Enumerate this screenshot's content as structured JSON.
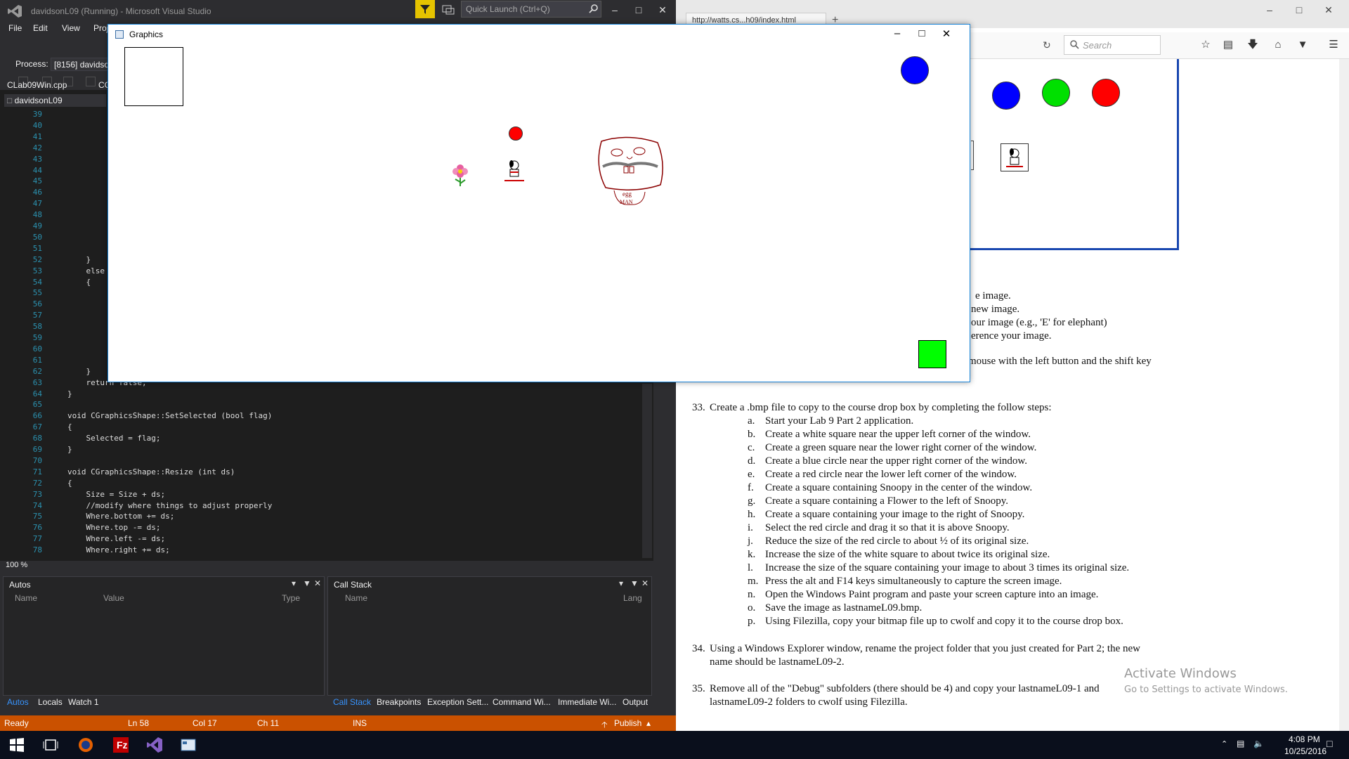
{
  "vs": {
    "title": "davidsonL09 (Running) - Microsoft Visual Studio",
    "quick_launch_placeholder": "Quick Launch (Ctrl+Q)",
    "menu": [
      "File",
      "Edit",
      "View",
      "Proj"
    ],
    "process_label": "Process:",
    "process_value": "[8156] davidso",
    "doc_tabs": [
      "CLab09Win.cpp",
      "CG"
    ],
    "nav_scope": "davidsonL09",
    "zoom": "100 %",
    "code_lines": [
      {
        "n": "39",
        "t": ""
      },
      {
        "n": "40",
        "t": ""
      },
      {
        "n": "41",
        "t": ""
      },
      {
        "n": "42",
        "t": ""
      },
      {
        "n": "43",
        "t": ""
      },
      {
        "n": "44",
        "t": ""
      },
      {
        "n": "45",
        "t": ""
      },
      {
        "n": "46",
        "t": ""
      },
      {
        "n": "47",
        "t": ""
      },
      {
        "n": "48",
        "t": ""
      },
      {
        "n": "49",
        "t": ""
      },
      {
        "n": "50",
        "t": ""
      },
      {
        "n": "51",
        "t": ""
      },
      {
        "n": "52",
        "t": "    }"
      },
      {
        "n": "53",
        "t": "    else"
      },
      {
        "n": "54",
        "t": "    {"
      },
      {
        "n": "55",
        "t": ""
      },
      {
        "n": "56",
        "t": ""
      },
      {
        "n": "57",
        "t": ""
      },
      {
        "n": "58",
        "t": ""
      },
      {
        "n": "59",
        "t": ""
      },
      {
        "n": "60",
        "t": ""
      },
      {
        "n": "61",
        "t": ""
      },
      {
        "n": "62",
        "t": "    }"
      },
      {
        "n": "63",
        "t": "    return false;"
      },
      {
        "n": "64",
        "t": "}"
      },
      {
        "n": "65",
        "t": ""
      },
      {
        "n": "66",
        "t": "void CGraphicsShape::SetSelected (bool flag)"
      },
      {
        "n": "67",
        "t": "{"
      },
      {
        "n": "68",
        "t": "    Selected = flag;"
      },
      {
        "n": "69",
        "t": "}"
      },
      {
        "n": "70",
        "t": ""
      },
      {
        "n": "71",
        "t": "void CGraphicsShape::Resize (int ds)"
      },
      {
        "n": "72",
        "t": "{"
      },
      {
        "n": "73",
        "t": "    Size = Size + ds;"
      },
      {
        "n": "74",
        "t": "    //modify where things to adjust properly"
      },
      {
        "n": "75",
        "t": "    Where.bottom += ds;"
      },
      {
        "n": "76",
        "t": "    Where.top -= ds;"
      },
      {
        "n": "77",
        "t": "    Where.left -= ds;"
      },
      {
        "n": "78",
        "t": "    Where.right += ds;"
      }
    ],
    "autos": {
      "title": "Autos",
      "cols": [
        "Name",
        "Value",
        "Type"
      ]
    },
    "callstack": {
      "title": "Call Stack",
      "cols": [
        "Name",
        "Lang"
      ]
    },
    "bottom_tabs_left": [
      "Autos",
      "Locals",
      "Watch 1"
    ],
    "bottom_tabs_right": [
      "Call Stack",
      "Breakpoints",
      "Exception Sett...",
      "Command Wi...",
      "Immediate Wi...",
      "Output"
    ],
    "status": {
      "ready": "Ready",
      "ln": "Ln 58",
      "col": "Col 17",
      "ch": "Ch 11",
      "ins": "INS",
      "publish": "Publish"
    },
    "status_color": "#ca5100"
  },
  "browser": {
    "tab_title": "http://watts.cs...h09/index.html",
    "search_placeholder": "Search",
    "partial_lines": [
      "e image.",
      "new image.",
      "our image (e.g., 'E' for elephant)",
      "erence your image.",
      "mouse with the left button and the shift key"
    ],
    "item33_num": "33.",
    "item33": "Create a .bmp file to copy to the course drop box by completing the follow steps:",
    "steps": [
      {
        "l": "a.",
        "t": "Start your Lab 9 Part 2 application."
      },
      {
        "l": "b.",
        "t": "Create a white square near the upper left corner of the window."
      },
      {
        "l": "c.",
        "t": "Create a green square near the lower right corner of the window."
      },
      {
        "l": "d.",
        "t": "Create a blue circle near the upper right corner of the window."
      },
      {
        "l": "e.",
        "t": "Create a red circle near the lower left corner of the window."
      },
      {
        "l": "f.",
        "t": "Create a square containing Snoopy in the center of the window."
      },
      {
        "l": "g.",
        "t": "Create a square containing a Flower to the left of Snoopy."
      },
      {
        "l": "h.",
        "t": "Create a square containing your image to the right of Snoopy."
      },
      {
        "l": "i.",
        "t": "Select the red circle and drag it so that it is above Snoopy."
      },
      {
        "l": "j.",
        "t": "Reduce the size of the red circle to about ½ of its original size."
      },
      {
        "l": "k.",
        "t": "Increase the size of the white square to about twice its original size."
      },
      {
        "l": "l.",
        "t": "Increase the size of the square containing your image to about 3 times its original size."
      },
      {
        "l": "m.",
        "t": "Press the alt and F14 keys simultaneously to capture the screen image."
      },
      {
        "l": "n.",
        "t": "Open the Windows Paint program and paste your screen capture into an image."
      },
      {
        "l": "o.",
        "t": "Save the image as lastnameL09.bmp."
      },
      {
        "l": "p.",
        "t": "Using Filezilla, copy your bitmap file up to cwolf and copy it to the course drop box."
      }
    ],
    "item34_num": "34.",
    "item34_a": "Using a Windows Explorer window, rename the project folder that you just created for Part 2; the new",
    "item34_b": "name should be lastnameL09-2.",
    "item35_num": "35.",
    "item35_a": "Remove all of the \"Debug\" subfolders (there should be 4) and copy your lastnameL09-1 and",
    "item35_b": "lastnameL09-2 folders to cwolf using Filezilla.",
    "activate_title": "Activate Windows",
    "activate_sub": "Go to Settings to activate Windows."
  },
  "graphics": {
    "title": "Graphics",
    "colors": {
      "blue": "#0000ff",
      "green": "#00ff00",
      "red": "#ff0000"
    }
  },
  "taskbar": {
    "time": "4:08 PM",
    "date": "10/25/2016"
  }
}
